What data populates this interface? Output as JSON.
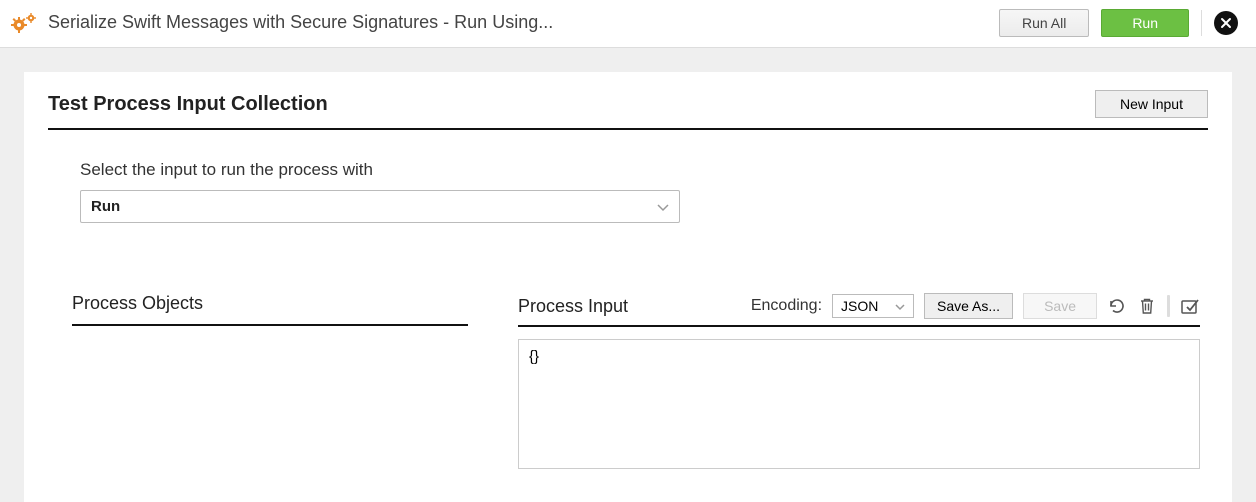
{
  "header": {
    "title": "Serialize Swift Messages with Secure Signatures - Run Using...",
    "run_all_label": "Run All",
    "run_label": "Run"
  },
  "panel": {
    "title": "Test Process Input Collection",
    "new_input_label": "New Input"
  },
  "select": {
    "label": "Select the input to run the process with",
    "value": "Run"
  },
  "process_objects": {
    "title": "Process Objects"
  },
  "process_input": {
    "title": "Process Input",
    "encoding_label": "Encoding:",
    "encoding_value": "JSON",
    "save_as_label": "Save As...",
    "save_label": "Save",
    "body": "{}"
  }
}
